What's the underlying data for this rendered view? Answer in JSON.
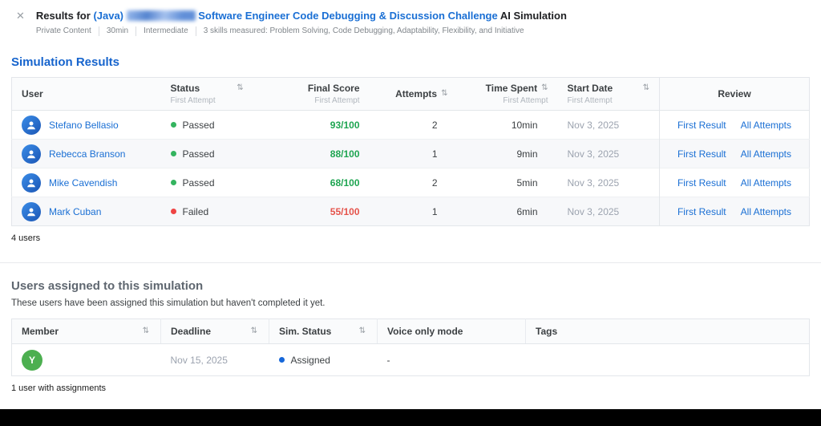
{
  "header": {
    "close_icon": "✕",
    "title_prefix": "Results for",
    "title_link_java": "(Java)",
    "title_link_rest": "Software Engineer Code Debugging & Discussion Challenge",
    "title_suffix": "AI Simulation",
    "meta": {
      "items": [
        "Private Content",
        "30min",
        "Intermediate",
        "3 skills measured: Problem Solving, Code Debugging, Adaptability, Flexibility, and Initiative"
      ]
    }
  },
  "results": {
    "title": "Simulation Results",
    "table": {
      "headers": {
        "user": "User",
        "status": "Status",
        "final_score": "Final Score",
        "attempts": "Attempts",
        "time_spent": "Time Spent",
        "start_date": "Start Date",
        "review": "Review",
        "sub_label": "First Attempt",
        "sort_icon": "⇅"
      },
      "rows": [
        {
          "user": "Stefano Bellasio",
          "status": "Passed",
          "status_key": "passed",
          "score": "93/100",
          "attempts": "2",
          "time_spent": "10min",
          "start_date": "Nov 3, 2025",
          "review_first": "First Result",
          "review_all": "All Attempts"
        },
        {
          "user": "Rebecca Branson",
          "status": "Passed",
          "status_key": "passed",
          "score": "88/100",
          "attempts": "1",
          "time_spent": "9min",
          "start_date": "Nov 3, 2025",
          "review_first": "First Result",
          "review_all": "All Attempts"
        },
        {
          "user": "Mike Cavendish",
          "status": "Passed",
          "status_key": "passed",
          "score": "68/100",
          "attempts": "2",
          "time_spent": "5min",
          "start_date": "Nov 3, 2025",
          "review_first": "First Result",
          "review_all": "All Attempts"
        },
        {
          "user": "Mark Cuban",
          "status": "Failed",
          "status_key": "failed",
          "score": "55/100",
          "attempts": "1",
          "time_spent": "6min",
          "start_date": "Nov 3, 2025",
          "review_first": "First Result",
          "review_all": "All Attempts"
        }
      ]
    },
    "footer": "4 users"
  },
  "assigned": {
    "title": "Users assigned to this simulation",
    "subtitle": "These users have been assigned this simulation but haven't completed it yet.",
    "table": {
      "headers": {
        "member": "Member",
        "deadline": "Deadline",
        "sim_status": "Sim. Status",
        "voice_only": "Voice only mode",
        "tags": "Tags",
        "sort_icon": "⇅"
      },
      "rows": [
        {
          "avatar_initial": "Y",
          "deadline": "Nov 15, 2025",
          "status": "Assigned",
          "status_key": "assigned",
          "voice_only": "-",
          "tags": ""
        }
      ]
    },
    "footer": "1 user with assignments"
  },
  "colors": {
    "accent_blue": "#1a6fd4",
    "pass_green": "#1ea551",
    "fail_red": "#e5534b",
    "assigned_blue": "#1667d9"
  }
}
